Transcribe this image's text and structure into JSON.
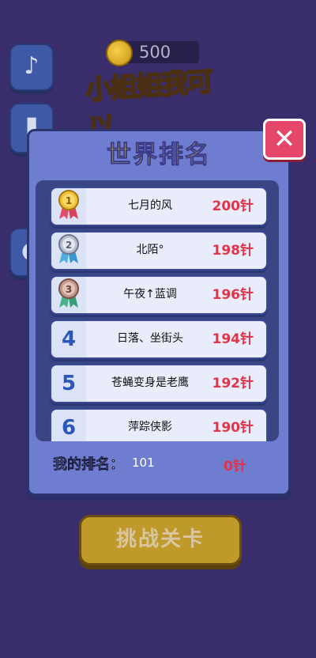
{
  "header": {
    "coins": "500",
    "logo_text": "小姐姐我可以"
  },
  "side_buttons": [
    {
      "icon": "music-note-icon",
      "glyph": "♪"
    },
    {
      "icon": "chart-icon",
      "glyph": "▮"
    },
    {
      "icon": "share-icon",
      "glyph": "◐"
    }
  ],
  "modal": {
    "title": "世界排名",
    "close_glyph": "✕",
    "rankings": [
      {
        "rank": "1",
        "name": "七月的风",
        "score": "200针",
        "medal": "gold"
      },
      {
        "rank": "2",
        "name": "北陌°",
        "score": "198针",
        "medal": "silver"
      },
      {
        "rank": "3",
        "name": "午夜↑蓝调",
        "score": "196针",
        "medal": "bronze"
      },
      {
        "rank": "4",
        "name": "日落、坐街头",
        "score": "194针",
        "medal": ""
      },
      {
        "rank": "5",
        "name": "苍蝇变身是老鹰",
        "score": "192针",
        "medal": ""
      },
      {
        "rank": "6",
        "name": "萍踪侠影",
        "score": "190针",
        "medal": ""
      }
    ],
    "my_rank_label": "我的排名：",
    "my_rank_value": "101",
    "my_score": "0针"
  },
  "start_button_label": "挑战关卡",
  "colors": {
    "gold": "#f0c23a",
    "silver": "#b9bfd0",
    "bronze": "#c4988e",
    "score": "#e0344a",
    "title": "#f7f05a"
  }
}
